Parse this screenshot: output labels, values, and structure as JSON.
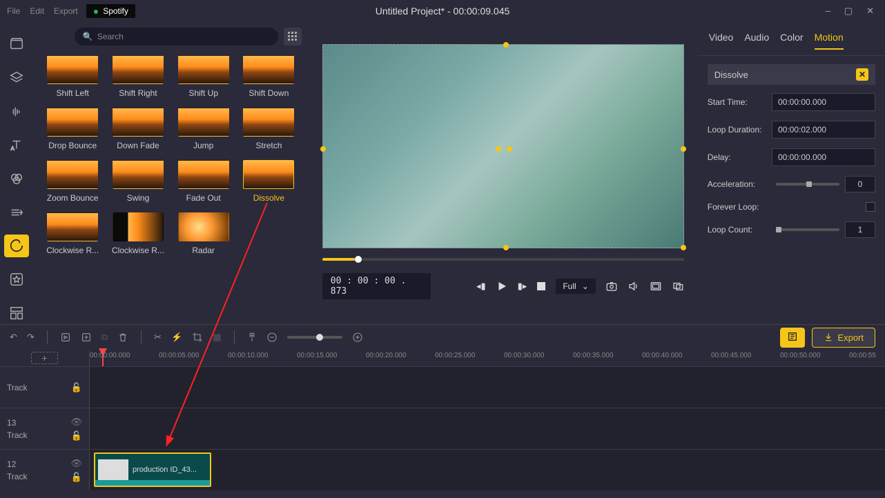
{
  "titlebar": {
    "spotify": "Spotify",
    "menus": [
      "File",
      "Edit",
      "Export"
    ],
    "title": "Untitled Project* - 00:00:09.045",
    "min": "–",
    "max": "▢",
    "close": "✕"
  },
  "search": {
    "placeholder": "Search"
  },
  "effects": [
    {
      "label": "Shift Left"
    },
    {
      "label": "Shift Right"
    },
    {
      "label": "Shift Up"
    },
    {
      "label": "Shift Down"
    },
    {
      "label": "Drop Bounce"
    },
    {
      "label": "Down Fade"
    },
    {
      "label": "Jump"
    },
    {
      "label": "Stretch"
    },
    {
      "label": "Zoom Bounce"
    },
    {
      "label": "Swing"
    },
    {
      "label": "Fade Out"
    },
    {
      "label": "Dissolve",
      "selected": true
    },
    {
      "label": "Clockwise R..."
    },
    {
      "label": "Clockwise R...",
      "thumb": "clock2"
    },
    {
      "label": "Radar",
      "thumb": "radar"
    }
  ],
  "preview": {
    "time": "00 : 00 : 00 . 873",
    "quality": "Full"
  },
  "props": {
    "tabs": [
      "Video",
      "Audio",
      "Color",
      "Motion"
    ],
    "active_tab": "Motion",
    "effect_name": "Dissolve",
    "rows": {
      "start_time": {
        "label": "Start Time:",
        "value": "00:00:00.000"
      },
      "loop_duration": {
        "label": "Loop Duration:",
        "value": "00:00:02.000"
      },
      "delay": {
        "label": "Delay:",
        "value": "00:00:00.000"
      },
      "acceleration": {
        "label": "Acceleration:",
        "value": "0"
      },
      "forever_loop": {
        "label": "Forever Loop:"
      },
      "loop_count": {
        "label": "Loop Count:",
        "value": "1"
      }
    }
  },
  "toolbar": {
    "export": "Export"
  },
  "ruler_ticks": [
    "00:00:00.000",
    "00:00:05.000",
    "00:00:10.000",
    "00:00:15.000",
    "00:00:20.000",
    "00:00:25.000",
    "00:00:30.000",
    "00:00:35.000",
    "00:00:40.000",
    "00:00:45.000",
    "00:00:50.000",
    "00:00:55"
  ],
  "tracks": {
    "t0": {
      "label": "Track"
    },
    "t13": {
      "num": "13",
      "label": "Track"
    },
    "t12": {
      "num": "12",
      "label": "Track"
    }
  },
  "clip": {
    "label": "production ID_43..."
  }
}
